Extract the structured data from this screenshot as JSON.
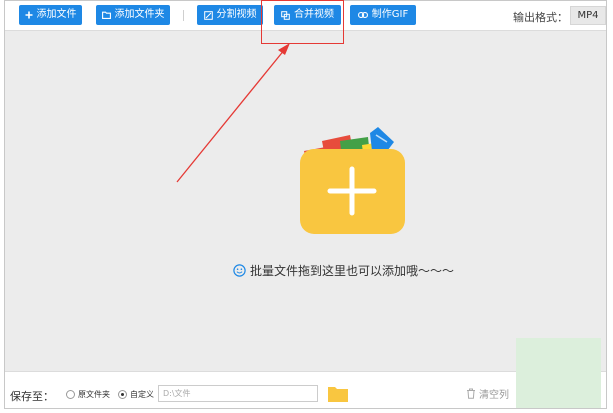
{
  "toolbar": {
    "add_file": "添加文件",
    "add_folder": "添加文件夹",
    "split_video": "分割视频",
    "merge_video": "合并视频",
    "make_gif": "制作GIF",
    "output_format_label": "输出格式：",
    "output_format_value": "MP4",
    "accent_color": "#1e88e5"
  },
  "annotation": {
    "highlight_color": "#e53935"
  },
  "dropzone": {
    "hint": "批量文件拖到这里也可以添加哦～～～",
    "folder_color": "#f9c640"
  },
  "footer": {
    "save_to_label": "保存至：",
    "option_original": "原文件夹",
    "option_custom": "自定义",
    "custom_selected": true,
    "path_placeholder": "D:\\文件",
    "clear_label": "清空列"
  }
}
